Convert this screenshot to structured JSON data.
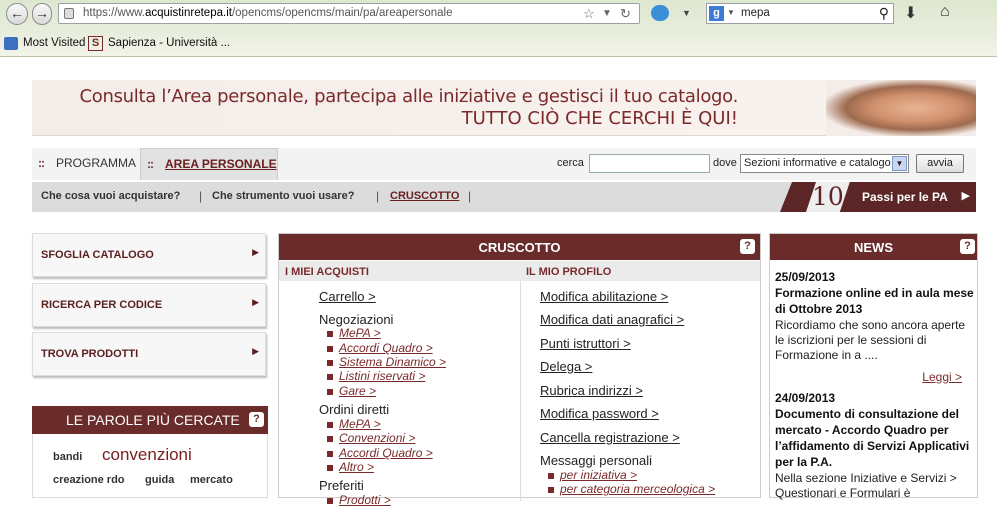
{
  "browser": {
    "url_prefix": "https://www.",
    "url_domain": "acquistinretepa.it",
    "url_path": "/opencms/opencms/main/pa/areapersonale",
    "search_engine_icon": "g",
    "search_value": "mepa",
    "bookmarks": [
      "Most Visited",
      "Sapienza - Università ..."
    ],
    "icons": {
      "back": "arrow-left-icon",
      "forward": "arrow-right-icon",
      "lock": "lock-icon",
      "star": "star-icon",
      "reload": "reload-icon",
      "download": "download-arrow-icon",
      "home": "home-icon"
    }
  },
  "banner": {
    "line1": "Consulta l’Area personale, partecipa alle iniziative e gestisci il tuo catalogo.",
    "line2": "TUTTO CIÒ CHE CERCHI È QUI!"
  },
  "topnav": {
    "tabs": [
      "PROGRAMMA",
      "AREA PERSONALE"
    ],
    "cerca_label": "cerca",
    "cerca_value": "",
    "dove_label": "dove",
    "dove_selected": "Sezioni informative e catalogo",
    "avvia": "avvia"
  },
  "subnav": {
    "items": [
      "Che cosa vuoi acquistare?",
      "Che strumento vuoi usare?",
      "CRUSCOTTO"
    ],
    "passi_number": "10",
    "passi_text": "Passi per le PA"
  },
  "sidebar": {
    "items": [
      "SFOGLIA CATALOGO",
      "RICERCA PER CODICE",
      "TROVA PRODOTTI"
    ],
    "parole_title": "LE PAROLE PIÙ CERCATE",
    "tags": [
      "bandi",
      "convenzioni",
      "creazione rdo",
      "guida",
      "mercato"
    ]
  },
  "cruscotto": {
    "title": "CRUSCOTTO",
    "col1_title": "I MIEI ACQUISTI",
    "col2_title": "IL MIO PROFILO",
    "carrello": "Carrello >",
    "negoziazioni": "Negoziazioni",
    "negoziazioni_items": [
      "MePA >",
      "Accordi Quadro >",
      "Sistema Dinamico >",
      "Listini riservati >",
      "Gare >"
    ],
    "ordini": "Ordini diretti",
    "ordini_items": [
      "MePA >",
      "Convenzioni >",
      "Accordi Quadro >",
      "Altro >"
    ],
    "preferiti": "Preferiti",
    "preferiti_items": [
      "Prodotti >"
    ],
    "profilo_links": [
      "Modifica abilitazione >",
      "Modifica dati anagrafici >",
      "Punti istruttori >",
      "Delega >",
      "Rubrica indirizzi >",
      "Modifica password >",
      "Cancella registrazione >"
    ],
    "messaggi": "Messaggi personali",
    "messaggi_items": [
      "per iniziativa >",
      "per categoria merceologica >"
    ]
  },
  "news": {
    "title": "NEWS",
    "items": [
      {
        "date": "25/09/2013",
        "title": "Formazione online ed in aula mese di Ottobre 2013",
        "text": "Ricordiamo che sono ancora aperte le iscrizioni per le sessioni di Formazione in a ....",
        "more": "Leggi >"
      },
      {
        "date": "24/09/2013",
        "title": "Documento di consultazione del mercato - Accordo Quadro per l’affidamento di Servizi Applicativi per la P.A.",
        "text": "Nella sezione Iniziative e Servizi > Questionari e Formulari è"
      }
    ]
  }
}
